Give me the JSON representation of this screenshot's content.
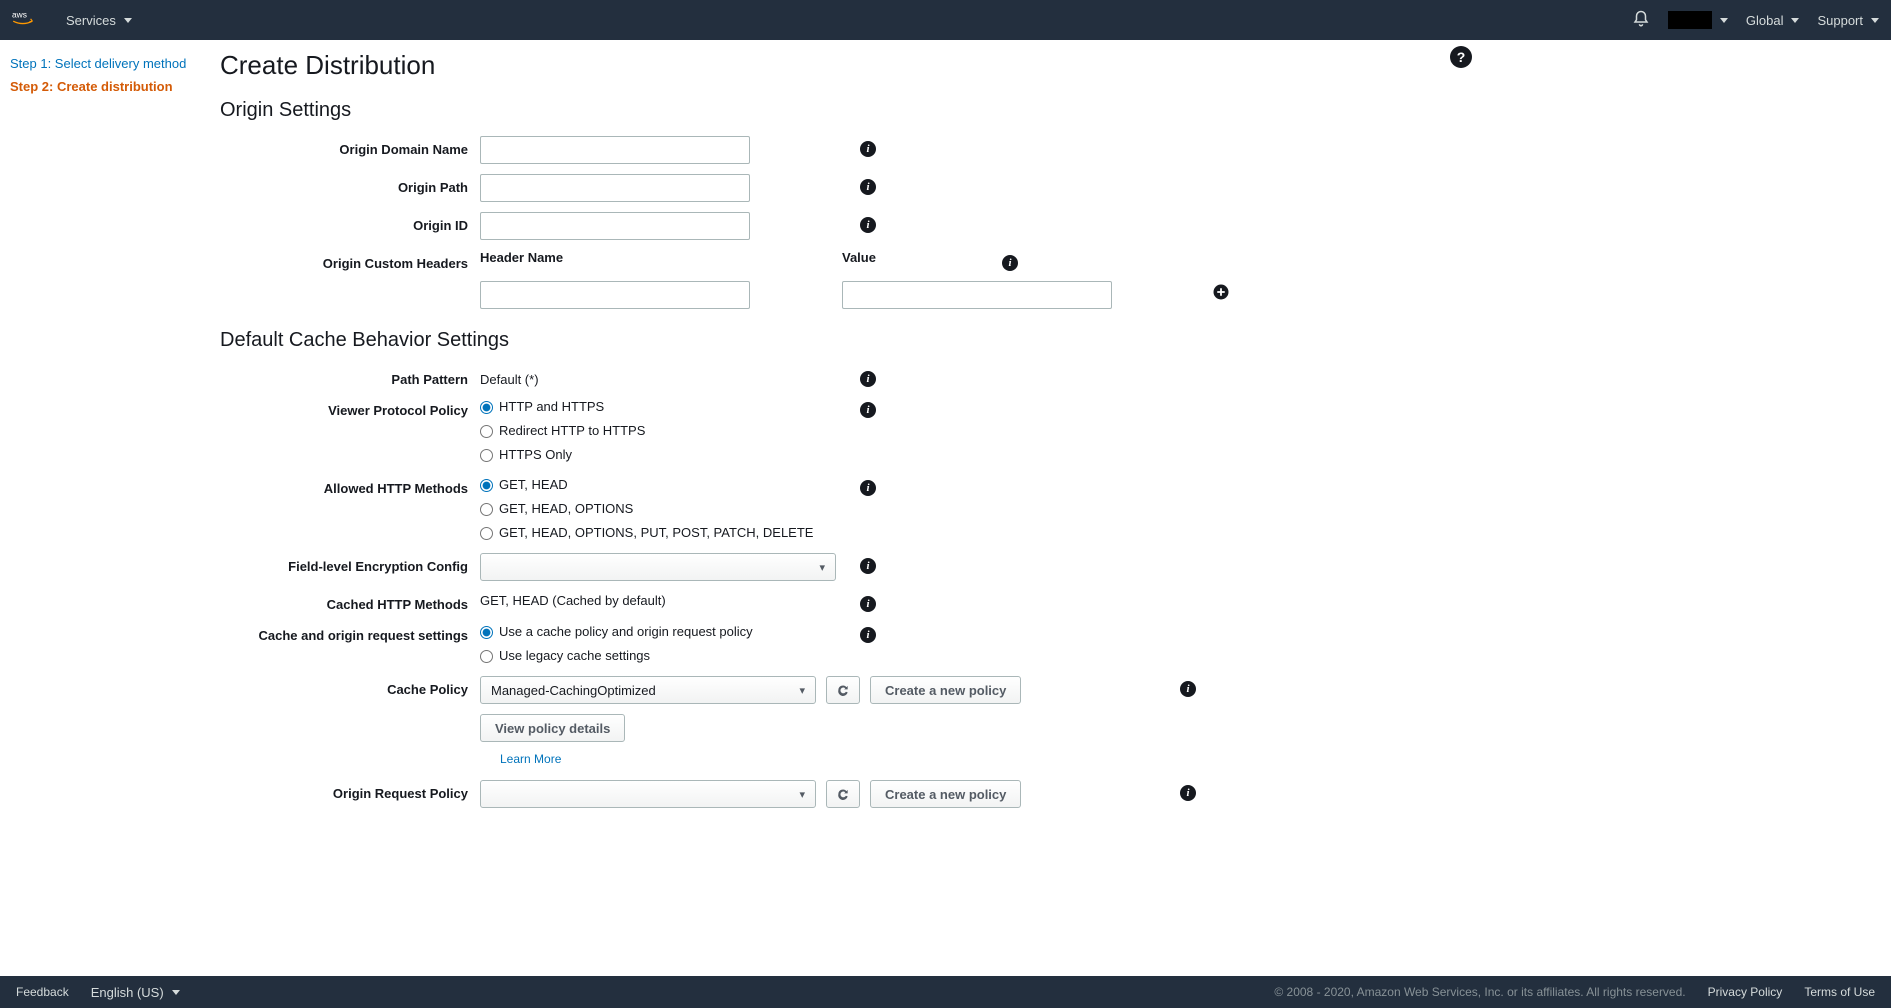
{
  "topbar": {
    "services": "Services",
    "global": "Global",
    "support": "Support"
  },
  "sidebar": {
    "step1": "Step 1: Select delivery method",
    "step2": "Step 2: Create distribution"
  },
  "page_title": "Create Distribution",
  "origin": {
    "heading": "Origin Settings",
    "domain_label": "Origin Domain Name",
    "path_label": "Origin Path",
    "id_label": "Origin ID",
    "custom_headers_label": "Origin Custom Headers",
    "header_name": "Header Name",
    "header_value": "Value"
  },
  "behavior": {
    "heading": "Default Cache Behavior Settings",
    "path_pattern_label": "Path Pattern",
    "path_pattern_value": "Default (*)",
    "viewer_protocol_label": "Viewer Protocol Policy",
    "vp_opt1": "HTTP and HTTPS",
    "vp_opt2": "Redirect HTTP to HTTPS",
    "vp_opt3": "HTTPS Only",
    "allowed_methods_label": "Allowed HTTP Methods",
    "am_opt1": "GET, HEAD",
    "am_opt2": "GET, HEAD, OPTIONS",
    "am_opt3": "GET, HEAD, OPTIONS, PUT, POST, PATCH, DELETE",
    "fle_label": "Field-level Encryption Config",
    "cached_methods_label": "Cached HTTP Methods",
    "cached_methods_value": "GET, HEAD (Cached by default)",
    "cache_settings_label": "Cache and origin request settings",
    "cs_opt1": "Use a cache policy and origin request policy",
    "cs_opt2": "Use legacy cache settings",
    "cache_policy_label": "Cache Policy",
    "cache_policy_selected": "Managed-CachingOptimized",
    "create_policy": "Create a new policy",
    "view_policy": "View policy details",
    "learn_more": "Learn More",
    "origin_request_label": "Origin Request Policy"
  },
  "footer": {
    "feedback": "Feedback",
    "lang": "English (US)",
    "legal": "© 2008 - 2020, Amazon Web Services, Inc. or its affiliates. All rights reserved.",
    "privacy": "Privacy Policy",
    "terms": "Terms of Use"
  }
}
